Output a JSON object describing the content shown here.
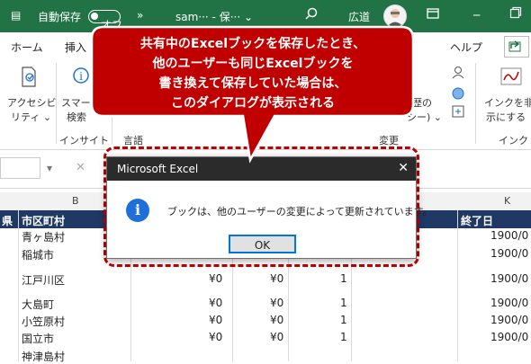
{
  "titlebar": {
    "autosave_label": "自動保存",
    "autosave_state": "オフ",
    "more": "»",
    "filename": "sam··· - 保··· ⌄",
    "search_icon": "magnifier",
    "user_name": "広道"
  },
  "tabs": [
    {
      "label": "ホーム"
    },
    {
      "label": "挿入"
    },
    {
      "label": "ヘルプ"
    }
  ],
  "ribbon": {
    "accessibility_line1": "アクセシビ",
    "accessibility_line2": "リティ ⌄",
    "smart_line1": "スマー",
    "smart_line2": "検索",
    "group_insight": "インサイト",
    "group_lang": "言語",
    "group_change": "変更",
    "group_ink": "インク",
    "history_line1": "歴の",
    "history_line2": "シー) ⌄",
    "ink_line1": "インクを非",
    "ink_line2": "示にする ⌄"
  },
  "formula_bar": {
    "namebox_dropdown": "▾",
    "cancel": "✕"
  },
  "columns": {
    "b": "B",
    "k": "K"
  },
  "table_header": {
    "col_pref": "県",
    "col_city": "市区町村",
    "col_end": "終了日"
  },
  "rows": [
    {
      "city": "青ヶ島村",
      "a": "",
      "b": "",
      "c": "",
      "end": "1900/0"
    },
    {
      "city": "稲城市",
      "a": "",
      "b": "",
      "c": "",
      "end": "1900/0"
    },
    {
      "city": "江戸川区",
      "a": "¥0",
      "b": "¥0",
      "c": "1",
      "end": "1900/0"
    },
    {
      "city": "大島町",
      "a": "¥0",
      "b": "¥0",
      "c": "1",
      "end": "1900/0"
    },
    {
      "city": "小笠原村",
      "a": "¥0",
      "b": "¥0",
      "c": "1",
      "end": "1900/0"
    },
    {
      "city": "国立市",
      "a": "¥0",
      "b": "¥0",
      "c": "1",
      "end": "1900/0"
    },
    {
      "city": "神津島村",
      "a": "",
      "b": "",
      "c": "",
      "end": "1900/0"
    }
  ],
  "dialog": {
    "title": "Microsoft Excel",
    "close": "✕",
    "icon": "i",
    "message": "ブックは、他のユーザーの変更によって更新されています。",
    "ok": "OK"
  },
  "callout": {
    "line1": "共有中のExcelブックを保存したとき、",
    "line2": "他のユーザーも同じExcelブックを",
    "line3": "書き換えて保存していた場合は、",
    "line4": "このダイアログが表示される"
  },
  "colors": {
    "excel_green": "#217346",
    "header_navy": "#1f3864",
    "callout_red": "#c00000",
    "info_blue": "#1e6fd9"
  }
}
